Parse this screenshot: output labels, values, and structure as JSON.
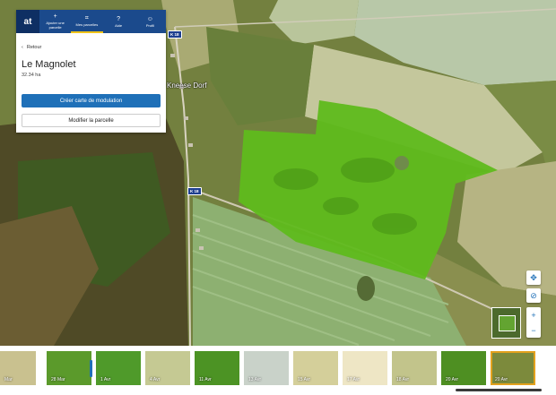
{
  "nav": {
    "logo": "at",
    "items": [
      {
        "icon": "plus-icon",
        "label": "Ajouter une parcelle"
      },
      {
        "icon": "fields-icon",
        "label": "Mes parcelles",
        "active": true
      },
      {
        "icon": "help-icon",
        "label": "Aide"
      },
      {
        "icon": "user-icon",
        "label": "Profil"
      }
    ]
  },
  "panel": {
    "back_label": "Retour",
    "field_name": "Le Magnolet",
    "field_area": "32.34 ha",
    "primary_button": "Créer carte de modulation",
    "secondary_button": "Modifier la parcelle"
  },
  "map": {
    "road_labels": [
      "K 18",
      "K 18"
    ],
    "place_label": "Kneese Dorf",
    "field_color": "#5fbb1c"
  },
  "timeline": {
    "thumbs": [
      {
        "label": "Mar",
        "tone": "#c9c18f",
        "selected": false
      },
      {
        "label": "28 Mar",
        "tone": "#5b9a2b",
        "selected": false
      },
      {
        "label": "1 Avr",
        "tone": "#4f9a2a",
        "selected": false
      },
      {
        "label": "4 Avr",
        "tone": "#c5c993",
        "selected": false
      },
      {
        "label": "11 Avr",
        "tone": "#4c9324",
        "selected": false
      },
      {
        "label": "13 Avr",
        "tone": "#c9d2c9",
        "selected": false
      },
      {
        "label": "15 Avr",
        "tone": "#d4cf9a",
        "selected": false
      },
      {
        "label": "17 Avr",
        "tone": "#eee6c5",
        "selected": false
      },
      {
        "label": "18 Avr",
        "tone": "#c2c48b",
        "selected": false
      },
      {
        "label": "20 Avr",
        "tone": "#4e8f22",
        "selected": false
      },
      {
        "label": "20 Avr",
        "tone": "#7c8a3c",
        "selected": true
      }
    ]
  },
  "colors": {
    "nav_bg": "#1b4a8c",
    "primary": "#1f70b8",
    "selection": "#e3a11d"
  }
}
